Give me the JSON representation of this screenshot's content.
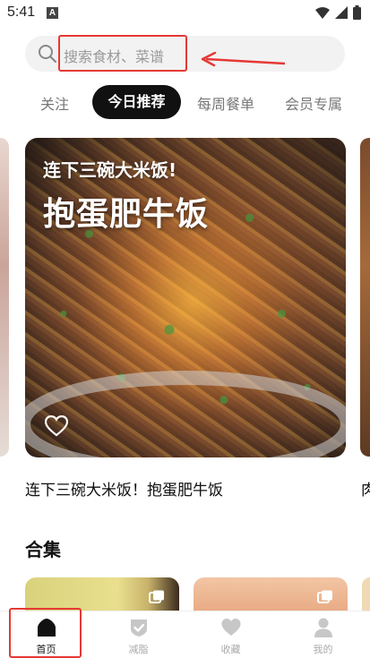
{
  "status_bar": {
    "time": "5:41",
    "app_icon": "A"
  },
  "search": {
    "placeholder": "搜索食材、菜谱"
  },
  "tabs": [
    {
      "label": "关注",
      "active": false
    },
    {
      "label": "今日推荐",
      "active": true
    },
    {
      "label": "每周餐单",
      "active": false
    },
    {
      "label": "会员专属",
      "active": false
    }
  ],
  "featured": {
    "subtitle": "连下三碗大米饭!",
    "title": "抱蛋肥牛饭",
    "caption": "连下三碗大米饭！抱蛋肥牛饭",
    "next_caption_partial": "肉"
  },
  "collections": {
    "title": "合集"
  },
  "bottom_nav": [
    {
      "label": "首页",
      "icon": "home-icon",
      "active": true
    },
    {
      "label": "减脂",
      "icon": "shield-check-icon",
      "active": false
    },
    {
      "label": "收藏",
      "icon": "heart-icon",
      "active": false
    },
    {
      "label": "我的",
      "icon": "user-icon",
      "active": false
    }
  ],
  "colors": {
    "accent": "#111111",
    "annotation": "#e53935",
    "inactive": "#aaaaaa"
  }
}
